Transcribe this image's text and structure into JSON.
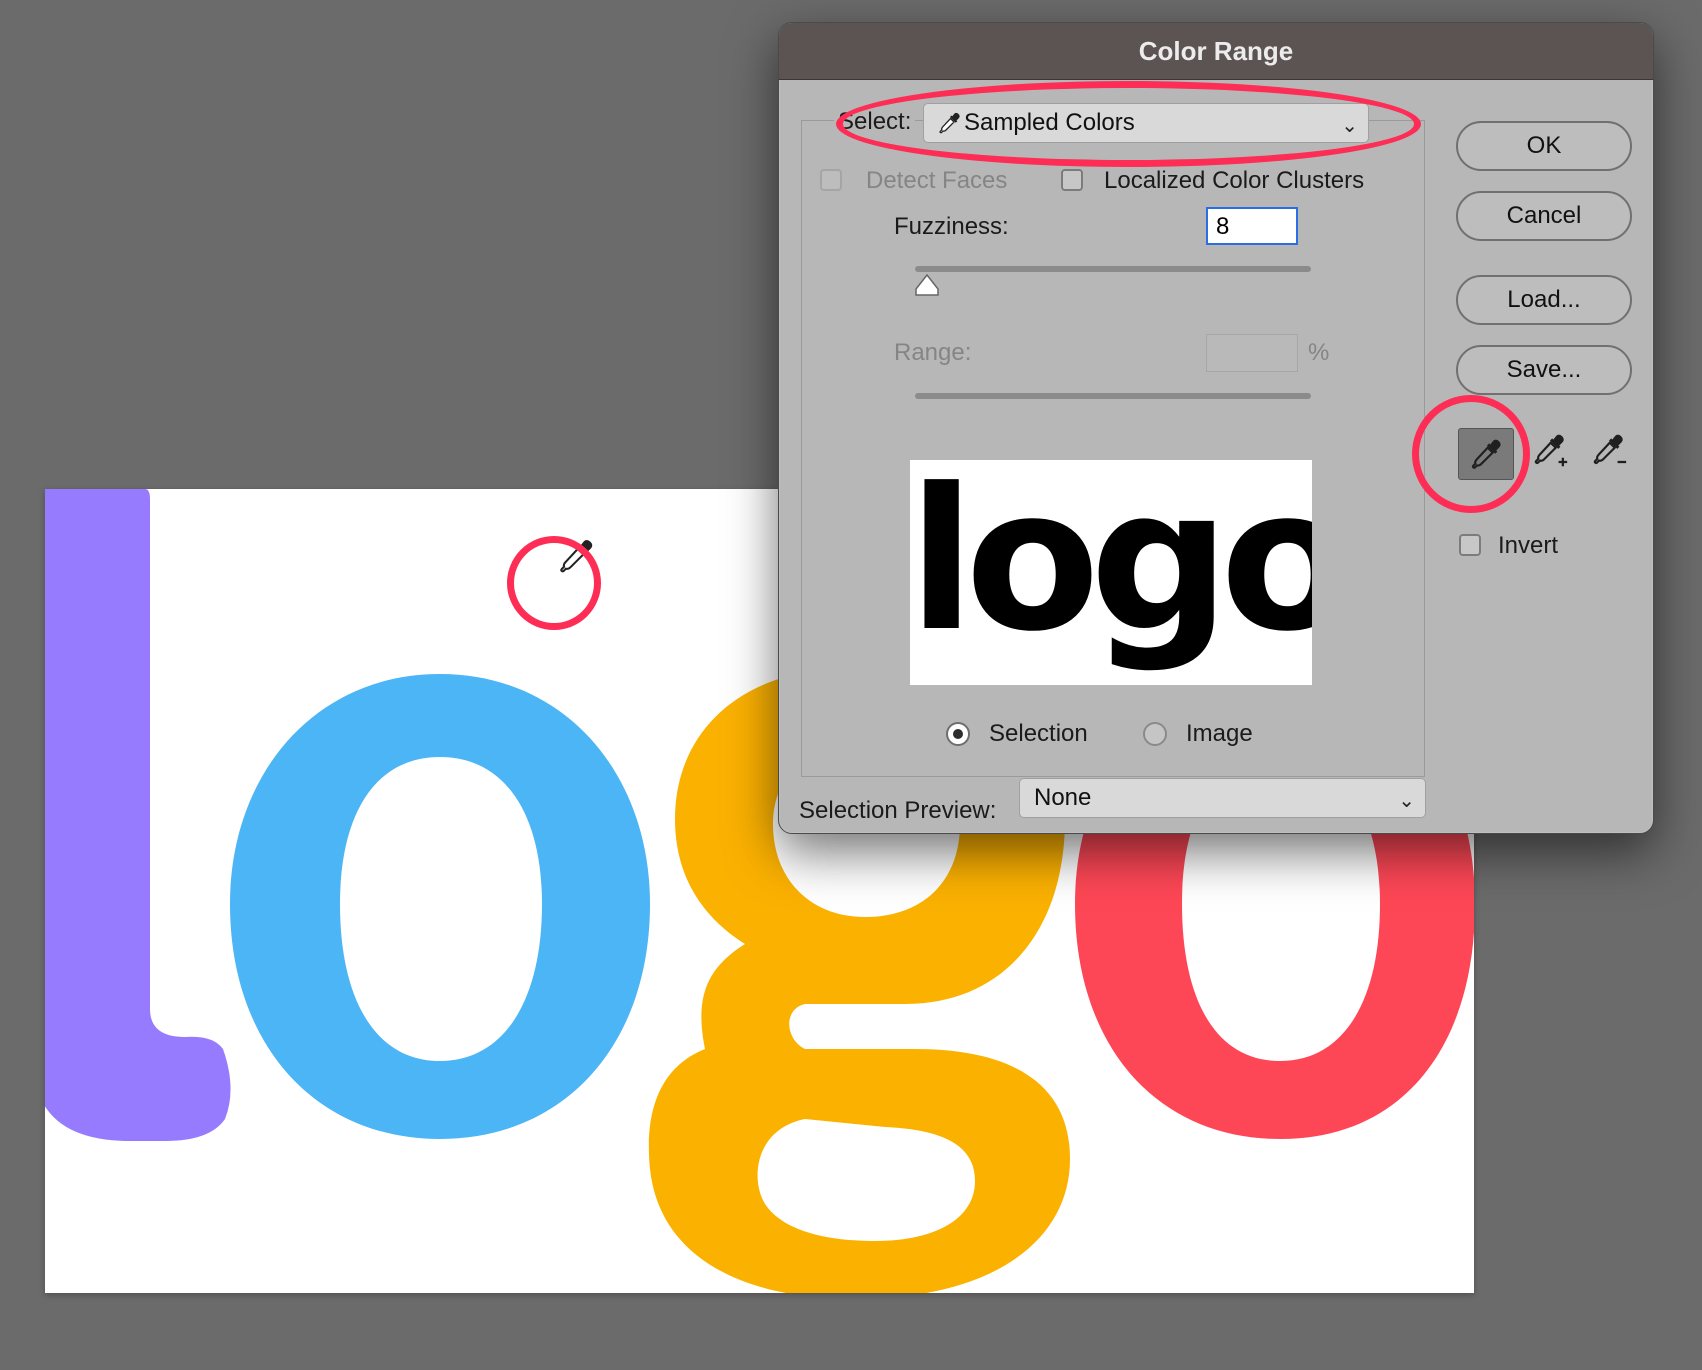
{
  "canvas": {
    "logo_letters": [
      "l",
      "o",
      "g",
      "o"
    ],
    "colors": {
      "l": "#967bff",
      "o1": "#4cb5f5",
      "g": "#fbb100",
      "o2": "#fe4756"
    },
    "cursor_icon": "eyedropper-icon"
  },
  "dialog": {
    "title": "Color Range",
    "select_label": "Select:",
    "select_value": "Sampled Colors",
    "select_icon": "eyedropper-icon",
    "detect_faces": {
      "label": "Detect Faces",
      "checked": false,
      "enabled": false
    },
    "localized_clusters": {
      "label": "Localized Color Clusters",
      "checked": false
    },
    "fuzziness_label": "Fuzziness:",
    "fuzziness_value": "8",
    "range_label": "Range:",
    "range_unit": "%",
    "preview_text": "logo",
    "radio_selection": "Selection",
    "radio_image": "Image",
    "radio_selected": "Selection",
    "selection_preview_label": "Selection Preview:",
    "selection_preview_value": "None",
    "buttons": {
      "ok": "OK",
      "cancel": "Cancel",
      "load": "Load...",
      "save": "Save..."
    },
    "tools": [
      "eyedropper-icon",
      "eyedropper-add-icon",
      "eyedropper-subtract-icon"
    ],
    "active_tool": "eyedropper-icon",
    "invert": {
      "label": "Invert",
      "checked": false
    }
  },
  "annotations": {
    "color": "#fe2d55"
  }
}
